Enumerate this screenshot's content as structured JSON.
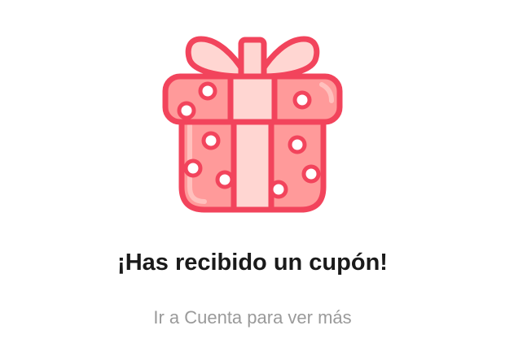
{
  "coupon_dialog": {
    "illustration_icon": "gift-box-icon",
    "title": "¡Has recibido un cupón!",
    "subtitle": "Ir a Cuenta para ver más"
  },
  "colors": {
    "stroke": "#f2445c",
    "box_fill": "#ff9a9a",
    "ribbon_fill": "#ffd6d2",
    "title_text": "#1a1a1a",
    "subtitle_text": "#9a9a9a"
  }
}
